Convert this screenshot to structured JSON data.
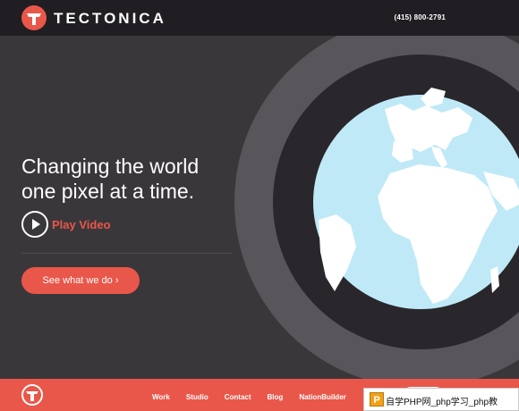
{
  "header": {
    "brand": "TECTONICA",
    "phone": "(415) 800-2791"
  },
  "hero": {
    "headline_line1": "Changing the world",
    "headline_line2": "one pixel at a time.",
    "play_label": "Play Video",
    "cta_label": "See what we do ›"
  },
  "footer": {
    "nav": [
      "Work",
      "Studio",
      "Contact",
      "Blog",
      "NationBuilder"
    ]
  },
  "watermark": {
    "badge": "P",
    "text": "自学PHP网_php学习_php教"
  },
  "colors": {
    "accent": "#e9574a",
    "topbar": "#201e22",
    "background": "#3a373b",
    "ocean": "#bfe9f6",
    "land": "#ffffff"
  },
  "icons": {
    "brand_mark": "tectonica-logo-icon",
    "play": "play-icon",
    "globe": "globe-icon"
  }
}
